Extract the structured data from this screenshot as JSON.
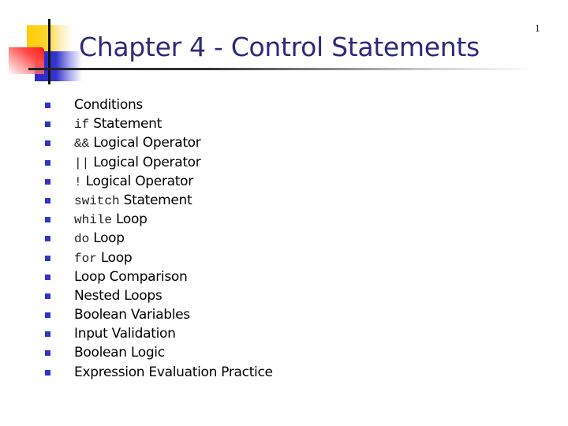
{
  "slide": {
    "title": "Chapter 4 - Control Statements",
    "page_number": "1",
    "accent_color": "#3333cc",
    "title_color": "#2b2b7a",
    "bullet_icon": "square-bullet-icon",
    "items": [
      {
        "code": "",
        "text": "Conditions"
      },
      {
        "code": "if",
        "text": "Statement"
      },
      {
        "code": "&&",
        "text": "Logical Operator"
      },
      {
        "code": "||",
        "text": "Logical Operator"
      },
      {
        "code": "!",
        "text": "Logical Operator"
      },
      {
        "code": "switch",
        "text": "Statement"
      },
      {
        "code": "while",
        "text": "Loop"
      },
      {
        "code": "do",
        "text": "Loop"
      },
      {
        "code": "for",
        "text": "Loop"
      },
      {
        "code": "",
        "text": "Loop Comparison"
      },
      {
        "code": "",
        "text": "Nested Loops"
      },
      {
        "code": "",
        "text": "Boolean Variables"
      },
      {
        "code": "",
        "text": "Input Validation"
      },
      {
        "code": "",
        "text": "Boolean Logic"
      },
      {
        "code": "",
        "text": "Expression Evaluation Practice"
      }
    ]
  }
}
